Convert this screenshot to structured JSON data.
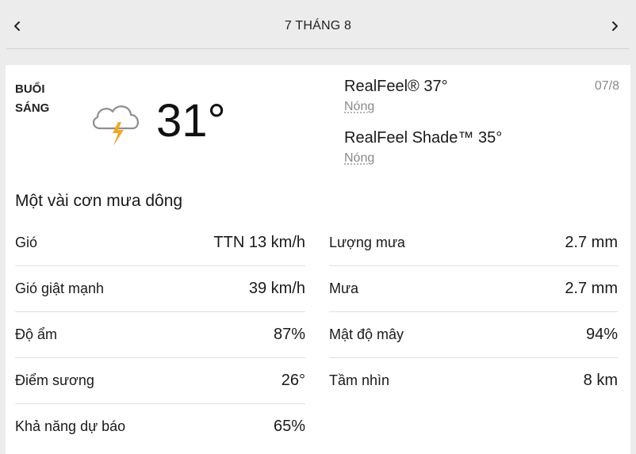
{
  "header": {
    "date": "7 THÁNG 8"
  },
  "icons": {
    "prev": "chevron-left-icon",
    "next": "chevron-right-icon",
    "weather": "thunderstorm-cloud-icon"
  },
  "colors": {
    "lightning": "#f5a623",
    "cloud_stroke": "#8e8e8e"
  },
  "forecast": {
    "period_line1": "BUỔI",
    "period_line2": "SÁNG",
    "temperature": "31°",
    "realfeel": {
      "label": "RealFeel® 37°",
      "desc": "Nóng"
    },
    "realfeel_shade": {
      "label": "RealFeel Shade™ 35°",
      "desc": "Nóng"
    },
    "date_short": "07/8",
    "phrase": "Một vài cơn mưa dông"
  },
  "details_left": [
    {
      "label": "Gió",
      "value": "TTN 13 km/h"
    },
    {
      "label": "Gió giật mạnh",
      "value": "39 km/h"
    },
    {
      "label": "Độ ẩm",
      "value": "87%"
    },
    {
      "label": "Điểm sương",
      "value": "26°"
    },
    {
      "label": "Khả năng dự báo",
      "value": "65%"
    }
  ],
  "details_right": [
    {
      "label": "Lượng mưa",
      "value": "2.7 mm"
    },
    {
      "label": "Mưa",
      "value": "2.7 mm"
    },
    {
      "label": "Mật độ mây",
      "value": "94%"
    },
    {
      "label": "Tầm nhìn",
      "value": "8 km"
    }
  ]
}
